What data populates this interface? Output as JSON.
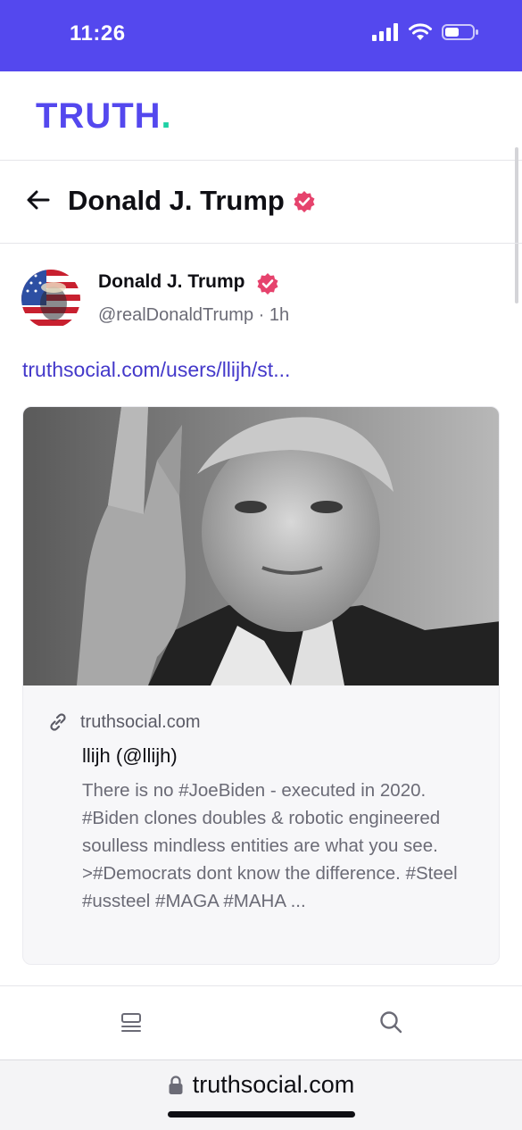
{
  "status_bar": {
    "time": "11:26"
  },
  "brand": {
    "wordmark": "TRUTH",
    "dot": ".",
    "accent": "#5448ee",
    "dot_color": "#1fd1a5"
  },
  "page_header": {
    "title": "Donald J. Trump"
  },
  "post": {
    "author_name": "Donald J. Trump",
    "handle": "@realDonaldTrump",
    "separator": "·",
    "time": "1h",
    "link_text": "truthsocial.com/users/llijh/st...",
    "card": {
      "domain": "truthsocial.com",
      "title": "llijh (@llijh)",
      "description": "There is no #JoeBiden - executed in 2020. #Biden clones doubles & robotic engineered soulless mindless entities are what you see. >#Democrats dont know the difference. #Steel #ussteel #MAGA #MAHA ..."
    }
  },
  "bottom_nav": {
    "items": [
      {
        "icon": "feed-icon"
      },
      {
        "icon": "search-icon"
      }
    ]
  },
  "browser": {
    "url": "truthsocial.com"
  },
  "colors": {
    "verified_badge": "#e6436d",
    "link": "#4338ca"
  }
}
